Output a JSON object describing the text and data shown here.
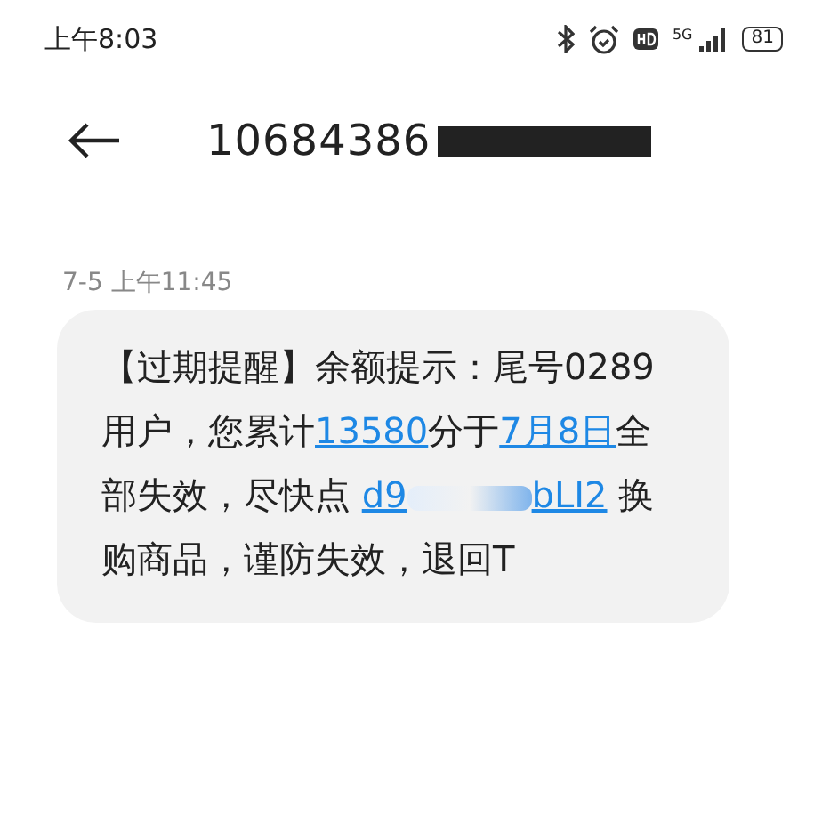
{
  "status_bar": {
    "time": "上午8:03",
    "network": "5G",
    "battery": "81"
  },
  "header": {
    "title": "10684386"
  },
  "message": {
    "timestamp": "7-5 上午11:45",
    "lines": [
      [
        {
          "kind": "text",
          "text": "【过期提醒】余额提示：尾号0289"
        }
      ],
      [
        {
          "kind": "text",
          "text": "用户，您累计"
        },
        {
          "kind": "link",
          "text": "13580"
        },
        {
          "kind": "text",
          "text": "分于"
        },
        {
          "kind": "link",
          "text": "7月8日"
        },
        {
          "kind": "text",
          "text": "全"
        }
      ],
      [
        {
          "kind": "text",
          "text": "部失效，尽快点 "
        },
        {
          "kind": "link",
          "text": "d9"
        },
        {
          "kind": "redacted"
        },
        {
          "kind": "link",
          "text": "bLI2"
        },
        {
          "kind": "text",
          "text": " 换"
        }
      ],
      [
        {
          "kind": "text",
          "text": "购商品，谨防失效，退回T"
        }
      ]
    ]
  }
}
